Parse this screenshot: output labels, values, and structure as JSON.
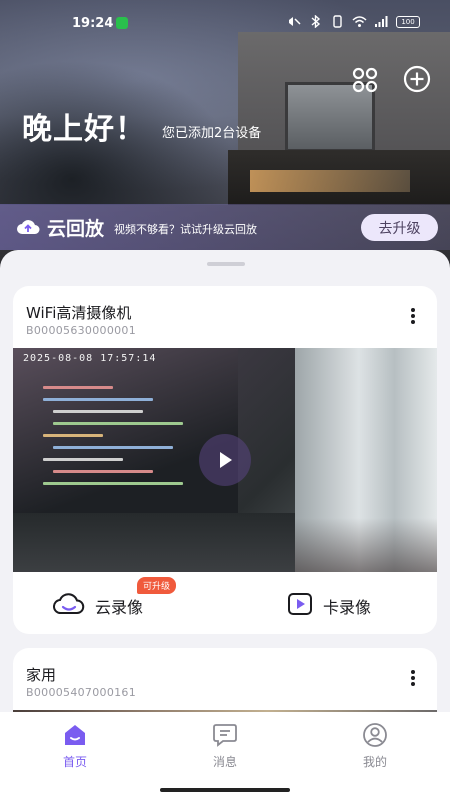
{
  "status_bar": {
    "time": "19:24",
    "battery": "100"
  },
  "header": {
    "greeting": "晚上好！",
    "device_count": "您已添加2台设备",
    "icons": [
      "scene-grid-icon",
      "add-circle-icon"
    ]
  },
  "cloud_banner": {
    "title": "云回放",
    "subtitle": "视频不够看？试试升级云回放",
    "button": "去升级",
    "icon": "cloud-upload-icon"
  },
  "devices": [
    {
      "name": "WiFi高清摄像机",
      "id": "B00005630000001",
      "timestamp": "2025-08-08 17:57:14",
      "cloud_record_label": "云录像",
      "cloud_record_badge": "可升级",
      "card_record_label": "卡录像"
    },
    {
      "name": "家用",
      "id": "B00005407000161"
    }
  ],
  "bottom_nav": {
    "items": [
      {
        "label": "首页",
        "icon": "home-icon",
        "active": true
      },
      {
        "label": "消息",
        "icon": "message-icon",
        "active": false
      },
      {
        "label": "我的",
        "icon": "profile-icon",
        "active": false
      }
    ]
  },
  "colors": {
    "accent": "#7a5cf0",
    "badge": "#f05a3c",
    "nav_inactive": "#8a8a92"
  }
}
